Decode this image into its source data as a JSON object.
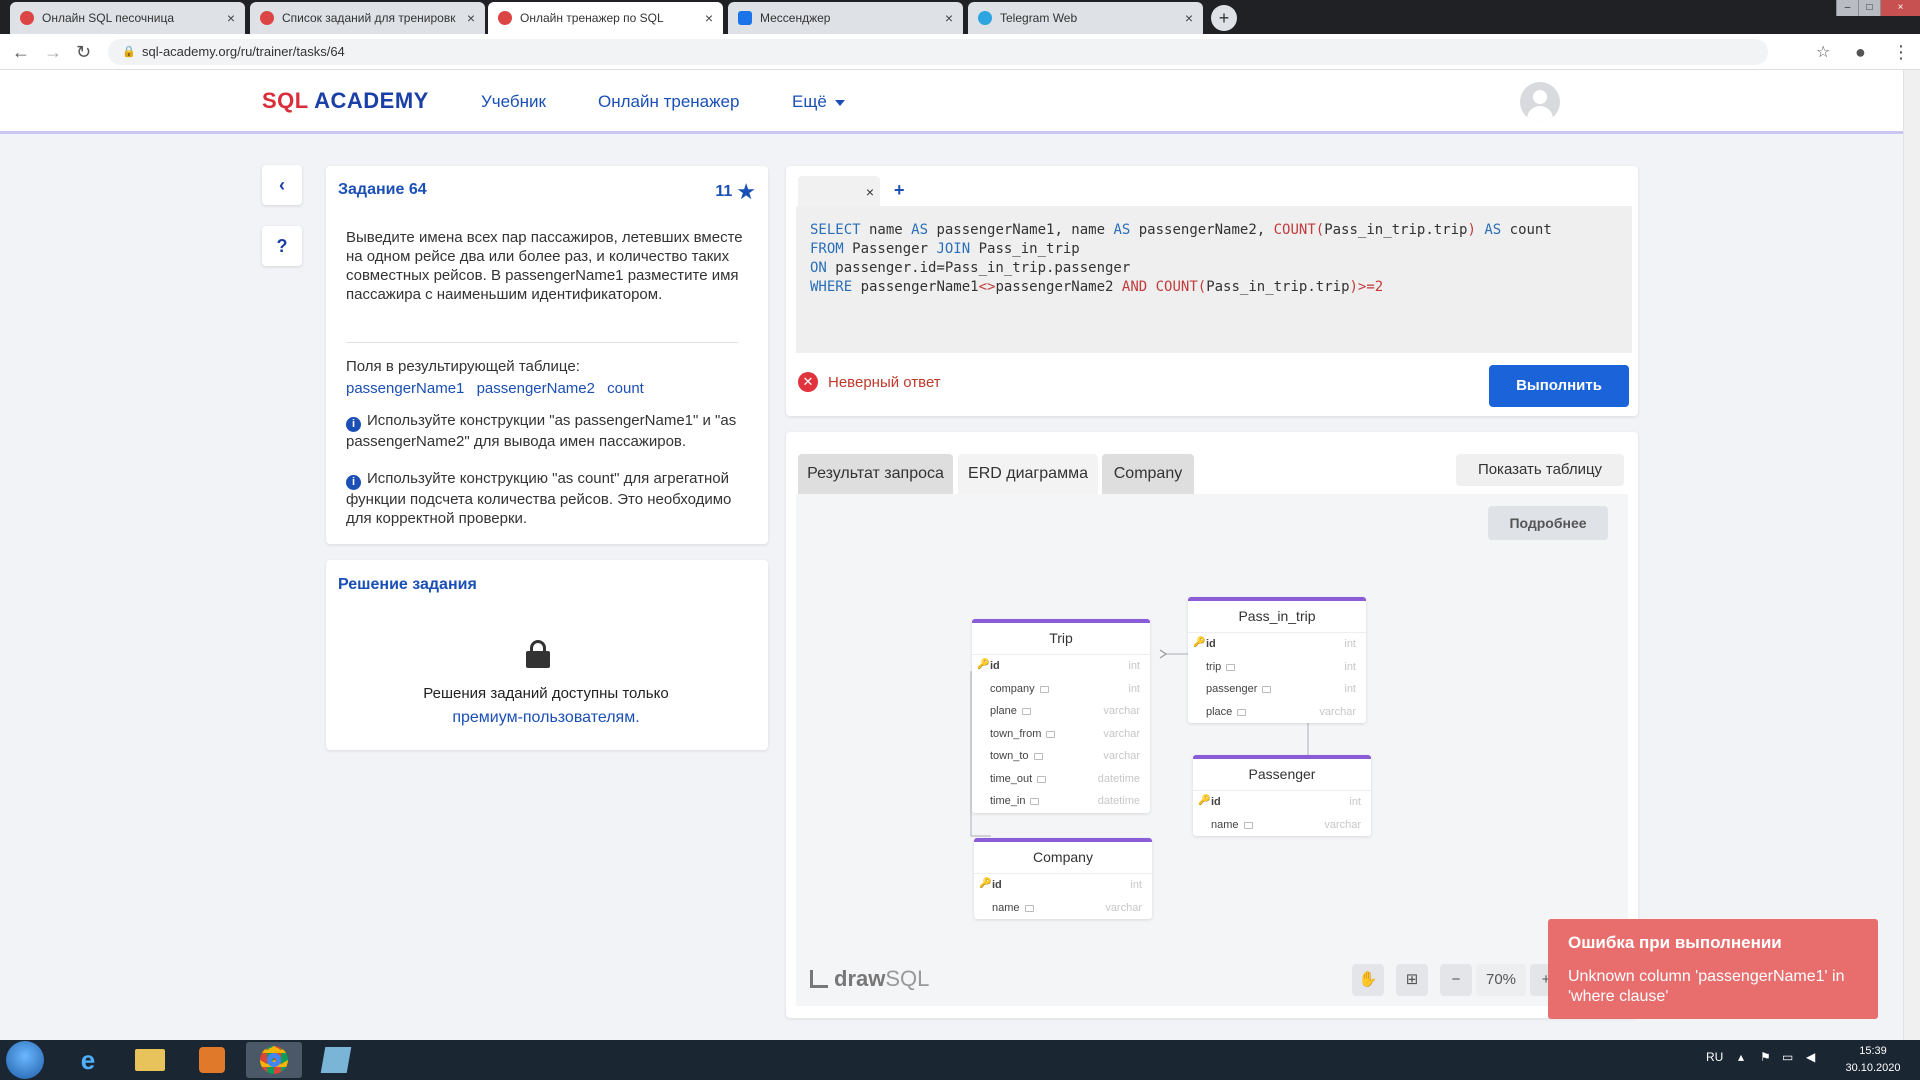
{
  "browser": {
    "tabs": [
      {
        "label": "Онлайн SQL песочница",
        "icon_color": "#d44"
      },
      {
        "label": "Список заданий для тренировк",
        "icon_color": "#d44"
      },
      {
        "label": "Онлайн тренажер по SQL",
        "icon_color": "#d44"
      },
      {
        "label": "Мессенджер",
        "icon_color": "#1a73e8"
      },
      {
        "label": "Telegram Web",
        "icon_color": "#2ca5e0"
      }
    ],
    "new_tab": "+",
    "url": "sql-academy.org/ru/trainer/tasks/64"
  },
  "site": {
    "logo_sql": "SQL",
    "logo_academy": "ACADEMY",
    "nav": {
      "textbook": "Учебник",
      "trainer": "Онлайн тренажер",
      "more": "Ещё"
    }
  },
  "side": {
    "back": "‹",
    "help": "?"
  },
  "task": {
    "title": "Задание 64",
    "score": "11",
    "description": "Выведите имена всех пар пассажиров, летевших вместе на одном рейсе два или более раз, и количество таких совместных рейсов. В passengerName1 разместите имя пассажира с наименьшим идентификатором.",
    "fields_label": "Поля в результирующей таблице:",
    "fields": [
      "passengerName1",
      "passengerName2",
      "count"
    ],
    "hint1": "Используйте конструкции \"as passengerName1\" и \"as passengerName2\" для вывода имен пассажиров.",
    "hint2": "Используйте конструкцию \"as count\" для агрегатной функции подсчета количества рейсов. Это необходимо для корректной проверки."
  },
  "solution": {
    "title": "Решение задания",
    "text": "Решения заданий доступны только",
    "link": "премиум-пользователям."
  },
  "editor": {
    "close": "×",
    "add": "+",
    "status": "Неверный ответ",
    "run": "Выполнить"
  },
  "results": {
    "tabs": [
      "Результат запроса",
      "ERD диаграмма",
      "Company"
    ],
    "show_table": "Показать таблицу",
    "details": "Подробнее",
    "brand_draw": "draw",
    "brand_sql": "SQL",
    "zoom": "70%",
    "zoom_out": "−",
    "zoom_in": "+"
  },
  "erd": {
    "trip": {
      "name": "Trip",
      "columns": [
        {
          "name": "id",
          "type": "int"
        },
        {
          "name": "company",
          "type": "int"
        },
        {
          "name": "plane",
          "type": "varchar"
        },
        {
          "name": "town_from",
          "type": "varchar"
        },
        {
          "name": "town_to",
          "type": "varchar"
        },
        {
          "name": "time_out",
          "type": "datetime"
        },
        {
          "name": "time_in",
          "type": "datetime"
        }
      ]
    },
    "company": {
      "name": "Company",
      "columns": [
        {
          "name": "id",
          "type": "int"
        },
        {
          "name": "name",
          "type": "varchar"
        }
      ]
    },
    "pass_in_trip": {
      "name": "Pass_in_trip",
      "columns": [
        {
          "name": "id",
          "type": "int"
        },
        {
          "name": "trip",
          "type": "int"
        },
        {
          "name": "passenger",
          "type": "int"
        },
        {
          "name": "place",
          "type": "varchar"
        }
      ]
    },
    "passenger": {
      "name": "Passenger",
      "columns": [
        {
          "name": "id",
          "type": "int"
        },
        {
          "name": "name",
          "type": "varchar"
        }
      ]
    }
  },
  "toast": {
    "title": "Ошибка при выполнении",
    "message": "Unknown column 'passengerName1' in 'where clause'"
  },
  "taskbar": {
    "lang": "RU",
    "time": "15:39",
    "date": "30.10.2020"
  },
  "colors": {
    "accent": "#1a4fb5",
    "brand_red": "#d92d3a",
    "run_button": "#1a63d9",
    "error": "#e86e6e",
    "erd_header": "#8a5cd8"
  }
}
